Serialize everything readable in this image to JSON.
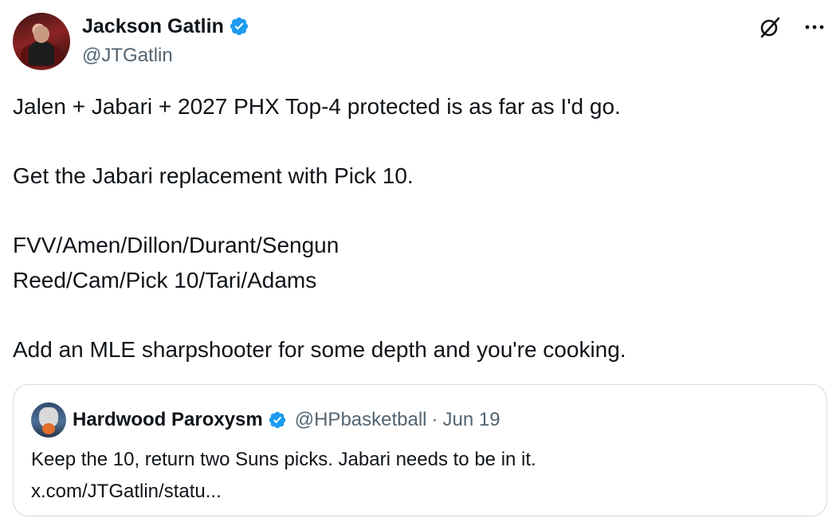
{
  "author": {
    "name": "Jackson Gatlin",
    "handle": "@JTGatlin",
    "verified": true
  },
  "icons": {
    "verified": "verified-badge-icon",
    "grok": "grok-icon",
    "more": "more-options-icon"
  },
  "colors": {
    "verified_blue": "#1d9bf0",
    "text_primary": "#0f1419",
    "text_secondary": "#536471",
    "border": "#cfd9de"
  },
  "tweet": {
    "lines": [
      "Jalen + Jabari + 2027 PHX Top-4 protected is as far as I'd go.",
      "",
      "Get the Jabari replacement with Pick 10.",
      "",
      "FVV/Amen/Dillon/Durant/Sengun",
      "Reed/Cam/Pick 10/Tari/Adams",
      "",
      "Add an MLE sharpshooter for some depth and you're cooking."
    ]
  },
  "quote": {
    "name": "Hardwood Paroxysm",
    "handle": "@HPbasketball",
    "separator": "·",
    "date": "Jun 19",
    "text": "Keep the 10, return two Suns picks. Jabari needs to be in it.",
    "link": "x.com/JTGatlin/statu..."
  }
}
